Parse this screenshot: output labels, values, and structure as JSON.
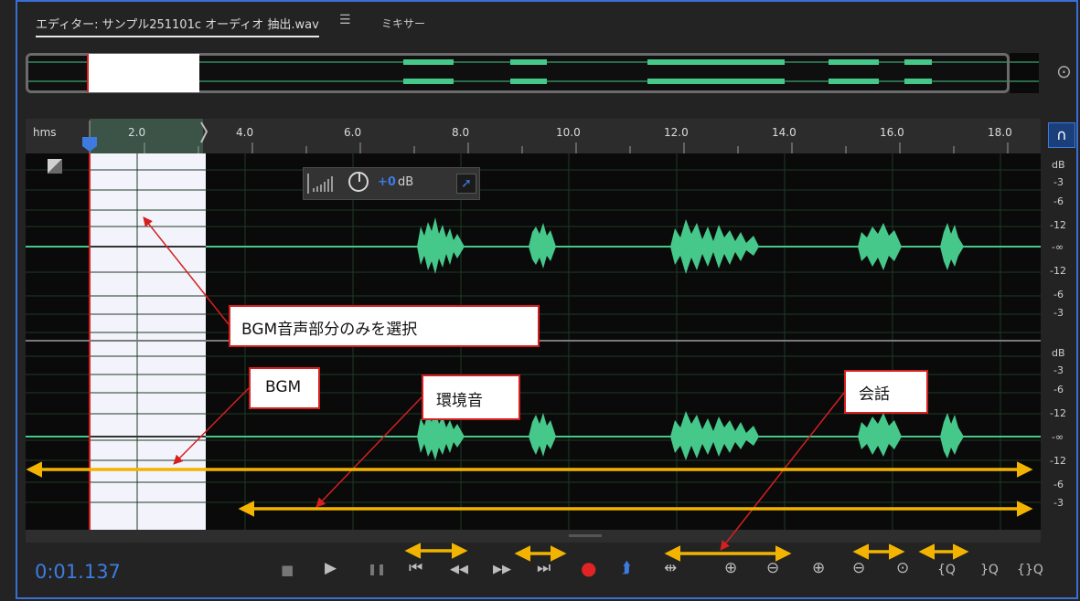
{
  "tabs": {
    "editor_label": "エディター: サンプル251101c オーディオ 抽出.wav",
    "menu_glyph": "☰",
    "mixer_label": "ミキサー"
  },
  "ruler": {
    "unit": "hms",
    "ticks": [
      "2.0",
      "4.0",
      "6.0",
      "8.0",
      "10.0",
      "12.0",
      "14.0",
      "16.0",
      "18.0"
    ]
  },
  "db_scale": {
    "ch1": [
      "dB",
      "-3",
      "-6",
      "-12",
      "-∞",
      "-12",
      "-6",
      "-3"
    ],
    "ch2": [
      "dB",
      "-3",
      "-6",
      "-12",
      "-∞",
      "-12",
      "-6",
      "-3"
    ]
  },
  "hud": {
    "gain_value": "+0",
    "gain_unit": "dB"
  },
  "annotations": {
    "select_bgm": "BGM音声部分のみを選択",
    "bgm": "BGM",
    "ambient": "環境音",
    "conversation": "会話"
  },
  "time": "0:01.137",
  "icons": {
    "stop": "■",
    "play": "▶",
    "pause": "❚❚",
    "to_start": "⏮",
    "rewind": "◀◀",
    "fast_forward": "▶▶",
    "to_end": "⏭",
    "record": "●",
    "loop": "⮭",
    "skip": "⇹",
    "zoom_in_amp": "⊕",
    "zoom_out_amp": "⊖",
    "zoom_in_time": "⊕",
    "zoom_out_time": "⊖",
    "zoom_full": "⊙",
    "zoom_in_left": "{Q",
    "zoom_in_right": "}Q",
    "zoom_selection": "{}Q",
    "magnet": "∩",
    "zoom": "⊙"
  },
  "colors": {
    "waveform": "#46c88a",
    "selection": "#f3f4fb",
    "annotation_border": "#d42020",
    "arrow_orange": "#f2b400",
    "accent_blue": "#3d7be0",
    "record_red": "#e02424"
  }
}
